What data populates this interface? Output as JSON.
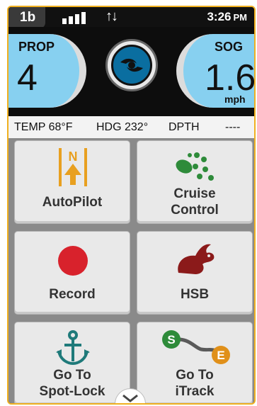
{
  "status": {
    "badge": "1b",
    "time": "3:26",
    "ampm": "PM",
    "signal_bars": 4
  },
  "gauges": {
    "prop": {
      "label": "PROP",
      "value": "4"
    },
    "sog": {
      "label": "SOG",
      "value": "1.6",
      "unit": "mph"
    }
  },
  "info": {
    "temp": "TEMP 68°F",
    "hdg": "HDG 232°",
    "dpth_label": "DPTH",
    "dpth_value": "----"
  },
  "tiles": [
    {
      "id": "autopilot",
      "lines": [
        "AutoPilot"
      ]
    },
    {
      "id": "cruise",
      "lines": [
        "Cruise",
        "Control"
      ]
    },
    {
      "id": "record",
      "lines": [
        "Record"
      ]
    },
    {
      "id": "hsb",
      "lines": [
        "HSB"
      ]
    },
    {
      "id": "spotlock",
      "lines": [
        "Go To",
        "Spot-Lock"
      ]
    },
    {
      "id": "itrack",
      "lines": [
        "Go To",
        "iTrack"
      ]
    }
  ],
  "itrack_icon": {
    "start": "S",
    "end": "E"
  },
  "autopilot_icon": {
    "letter": "N"
  },
  "colors": {
    "accent_border": "#f0b020",
    "gauge_blue": "#87d0f0",
    "prop_blue": "#0a6ea0",
    "record_red": "#d8222c",
    "cruise_green": "#2e8b3a",
    "hsb_red": "#8b1a1a",
    "anchor_teal": "#1f7a7a",
    "itrack_start": "#2e8b3a",
    "itrack_end": "#e0901a"
  },
  "icons": [
    "signal-icon",
    "data-arrows-icon",
    "propeller-icon",
    "autopilot-icon",
    "cruise-dots-icon",
    "record-dot-icon",
    "rabbit-icon",
    "anchor-icon",
    "route-icon",
    "chevron-down-icon"
  ]
}
